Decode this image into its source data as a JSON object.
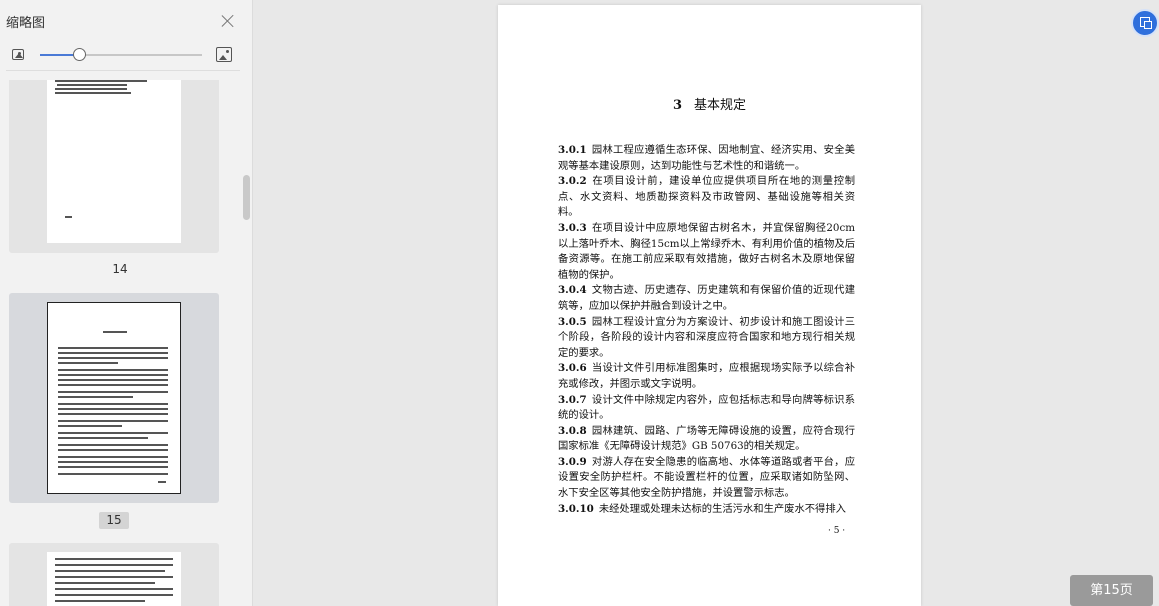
{
  "sidebar": {
    "title": "缩略图",
    "zoom_level_percent": 24,
    "thumbnails": [
      {
        "label": "14",
        "selected": false
      },
      {
        "label": "15",
        "selected": true
      }
    ]
  },
  "page": {
    "heading_number": "3",
    "heading_text": "基本规定",
    "clauses": [
      {
        "num": "3.0.1",
        "text": "园林工程应遵循生态环保、因地制宜、经济实用、安全美观等基本建设原则，达到功能性与艺术性的和谐统一。"
      },
      {
        "num": "3.0.2",
        "text": "在项目设计前，建设单位应提供项目所在地的测量控制点、水文资料、地质勘探资料及市政管网、基础设施等相关资料。"
      },
      {
        "num": "3.0.3",
        "text": "在项目设计中应原地保留古树名木，并宜保留胸径20cm以上落叶乔木、胸径15cm以上常绿乔木、有利用价值的植物及后备资源等。在施工前应采取有效措施，做好古树名木及原地保留植物的保护。"
      },
      {
        "num": "3.0.4",
        "text": "文物古迹、历史遗存、历史建筑和有保留价值的近现代建筑等，应加以保护并融合到设计之中。"
      },
      {
        "num": "3.0.5",
        "text": "园林工程设计宜分为方案设计、初步设计和施工图设计三个阶段，各阶段的设计内容和深度应符合国家和地方现行相关规定的要求。"
      },
      {
        "num": "3.0.6",
        "text": "当设计文件引用标准图集时，应根据现场实际予以综合补充或修改，并图示或文字说明。"
      },
      {
        "num": "3.0.7",
        "text": "设计文件中除规定内容外，应包括标志和导向牌等标识系统的设计。"
      },
      {
        "num": "3.0.8",
        "text": "园林建筑、园路、广场等无障碍设施的设置，应符合现行国家标准《无障碍设计规范》GB 50763的相关规定。"
      },
      {
        "num": "3.0.9",
        "text": "对游人存在安全隐患的临高地、水体等道路或者平台，应设置安全防护栏杆。不能设置栏杆的位置，应采取诸如防坠网、水下安全区等其他安全防护措施，并设置警示标志。"
      },
      {
        "num": "3.0.10",
        "text": "未经处理或处理未达标的生活污水和生产废水不得排入"
      }
    ],
    "page_number": "· 5 ·"
  },
  "footer": {
    "page_indicator": "第15页"
  },
  "icons": {
    "zoom_out": "image-small-icon",
    "zoom_in": "image-large-icon",
    "close": "close-icon",
    "fab": "screenshot-icon"
  },
  "colors": {
    "accent": "#2f6fdc",
    "page_bg": "#ffffff",
    "viewer_bg": "#e8e8e8"
  }
}
